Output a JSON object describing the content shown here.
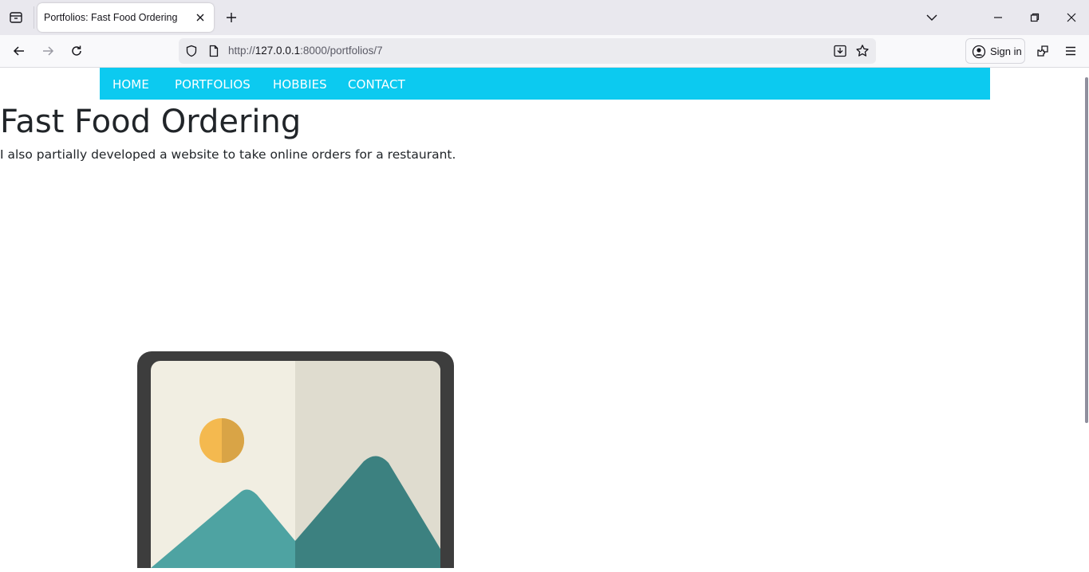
{
  "browser": {
    "tab": {
      "title": "Portfolios: Fast Food Ordering"
    },
    "url": {
      "scheme": "http://",
      "host": "127.0.0.1",
      "rest": ":8000/portfolios/7"
    },
    "sign_in_label": "Sign in"
  },
  "site_nav": {
    "items": [
      {
        "label": "HOME"
      },
      {
        "label": "PORTFOLIOS"
      },
      {
        "label": "HOBBIES"
      },
      {
        "label": "CONTACT"
      }
    ],
    "color": "#0ccaf0"
  },
  "page": {
    "title": "Fast Food Ordering",
    "description": "I also partially developed a website to take online orders for a restaurant."
  },
  "colors": {
    "image_frame": "#3d3d3d",
    "image_sky_left": "#f1eee2",
    "image_sky_right": "#dfdccf",
    "sun_left": "#f4b94f",
    "sun_right": "#d9a446",
    "mountain_left": "#4ea3a2",
    "mountain_right": "#3c8180"
  }
}
